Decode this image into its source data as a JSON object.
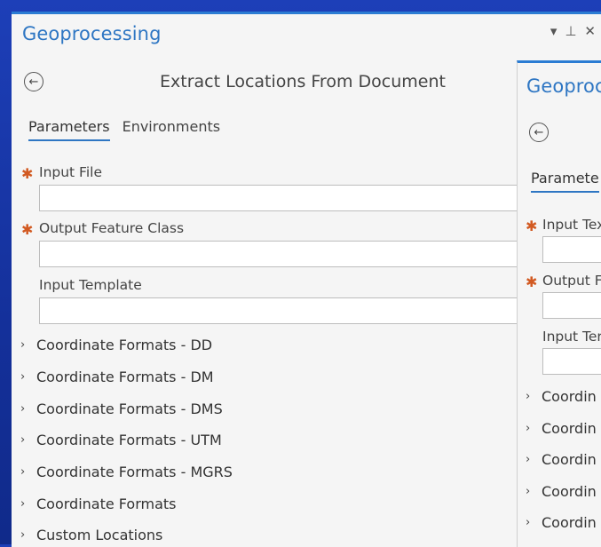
{
  "main_pane": {
    "title": "Geoprocessing",
    "controls": {
      "dropdown_glyph": "▾",
      "pin_glyph": "⊥",
      "close_glyph": "✕"
    },
    "back_glyph": "←",
    "tool_title": "Extract Locations From Document",
    "tabs": [
      {
        "label": "Parameters",
        "active": true
      },
      {
        "label": "Environments",
        "active": false
      }
    ],
    "required_marker": "✱",
    "parameters": [
      {
        "label": "Input File",
        "required": true,
        "value": ""
      },
      {
        "label": "Output Feature Class",
        "required": true,
        "value": ""
      },
      {
        "label": "Input Template",
        "required": false,
        "value": ""
      }
    ],
    "groups": [
      "Coordinate Formats - DD",
      "Coordinate Formats - DM",
      "Coordinate Formats - DMS",
      "Coordinate Formats - UTM",
      "Coordinate Formats - MGRS",
      "Coordinate Formats",
      "Custom Locations"
    ],
    "chevron_glyph": "›"
  },
  "second_pane": {
    "title": "Geoproc",
    "back_glyph": "←",
    "tab": "Paramete",
    "required_marker": "✱",
    "parameters": [
      {
        "label": "Input Tex",
        "required": true
      },
      {
        "label": "Output F",
        "required": true
      },
      {
        "label": "Input Ter",
        "required": false
      }
    ],
    "groups": [
      "Coordin",
      "Coordin",
      "Coordin",
      "Coordin",
      "Coordin"
    ],
    "chevron_glyph": "›"
  },
  "colors": {
    "background": "#1d3fb8",
    "accent": "#2e76c3",
    "required": "#d25a22",
    "pane": "#f5f5f5"
  }
}
